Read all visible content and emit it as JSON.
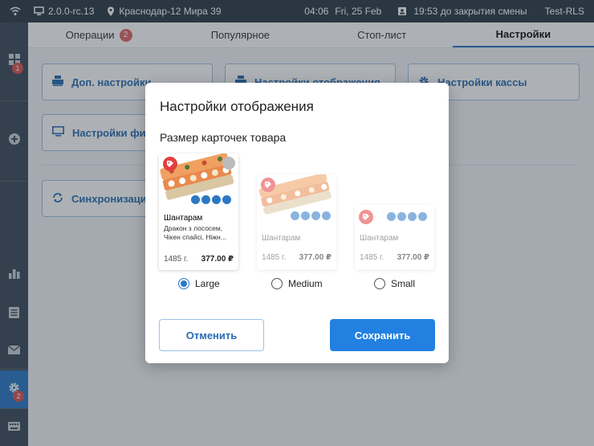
{
  "statusbar": {
    "version": "2.0.0-rc.13",
    "location": "Краснодар-12 Мира 39",
    "time": "04:06",
    "date": "Fri, 25 Feb",
    "shift": "19:53 до закрытия смены",
    "user": "Test-RLS"
  },
  "sidebar": {
    "items": [
      {
        "icon": "grid-icon",
        "badge": "1"
      },
      {
        "icon": "plus-circle-icon"
      },
      {
        "icon": "bar-chart-icon"
      },
      {
        "icon": "list-icon"
      },
      {
        "icon": "mail-icon"
      },
      {
        "icon": "gear-icon",
        "badge": "2",
        "active": true
      },
      {
        "icon": "keyboard-icon"
      }
    ]
  },
  "tabs": [
    {
      "label": "Операции",
      "badge": "2"
    },
    {
      "label": "Популярное"
    },
    {
      "label": "Стоп-лист"
    },
    {
      "label": "Настройки",
      "active": true
    }
  ],
  "tiles": {
    "advanced": "Доп. настройки",
    "display": "Настройки отображения",
    "cashbox": "Настройки кассы",
    "fiscal": "Настройки фиск",
    "sync": "Синхронизация"
  },
  "modal": {
    "title": "Настройки отображения",
    "subtitle": "Размер карточек товара",
    "cards": {
      "large": {
        "name": "Шантарам",
        "desc": "Дракон з лососем, Чікен спайсі, Ніжн...",
        "weight": "1485 г.",
        "price": "377.00 ₽"
      },
      "medium": {
        "name": "Шантарам",
        "weight": "1485 г.",
        "price": "377.00 ₽"
      },
      "small": {
        "name": "Шантарам",
        "weight": "1485 г.",
        "price": "377.00 ₽"
      }
    },
    "options": {
      "large": "Large",
      "medium": "Medium",
      "small": "Small",
      "selected": "Large"
    },
    "cancel": "Отменить",
    "save": "Сохранить"
  },
  "colors": {
    "accent": "#2280e0",
    "sidebar": "#3c4a58",
    "statusbar": "#2c3a48",
    "badge": "#d9534f"
  }
}
